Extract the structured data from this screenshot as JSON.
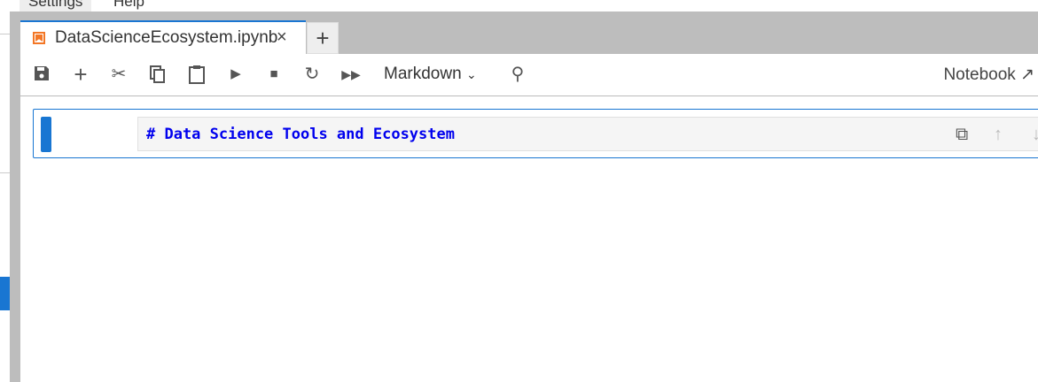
{
  "menubar": {
    "items": [
      "Settings",
      "Help"
    ]
  },
  "tab": {
    "title": "DataScienceEcosystem.ipynb",
    "close": "×",
    "add": "+",
    "icon": "notebook-icon"
  },
  "toolbar": {
    "save": "save-icon",
    "cell_type": "Markdown",
    "kernel_label": "Notebook",
    "open_icon": "external-link-icon"
  },
  "cell": {
    "source": "# Data Science Tools and Ecosystem"
  },
  "colors": {
    "accent": "#1976d2",
    "notebook_icon": "#f37726",
    "markdown_text": "#0000ee"
  }
}
